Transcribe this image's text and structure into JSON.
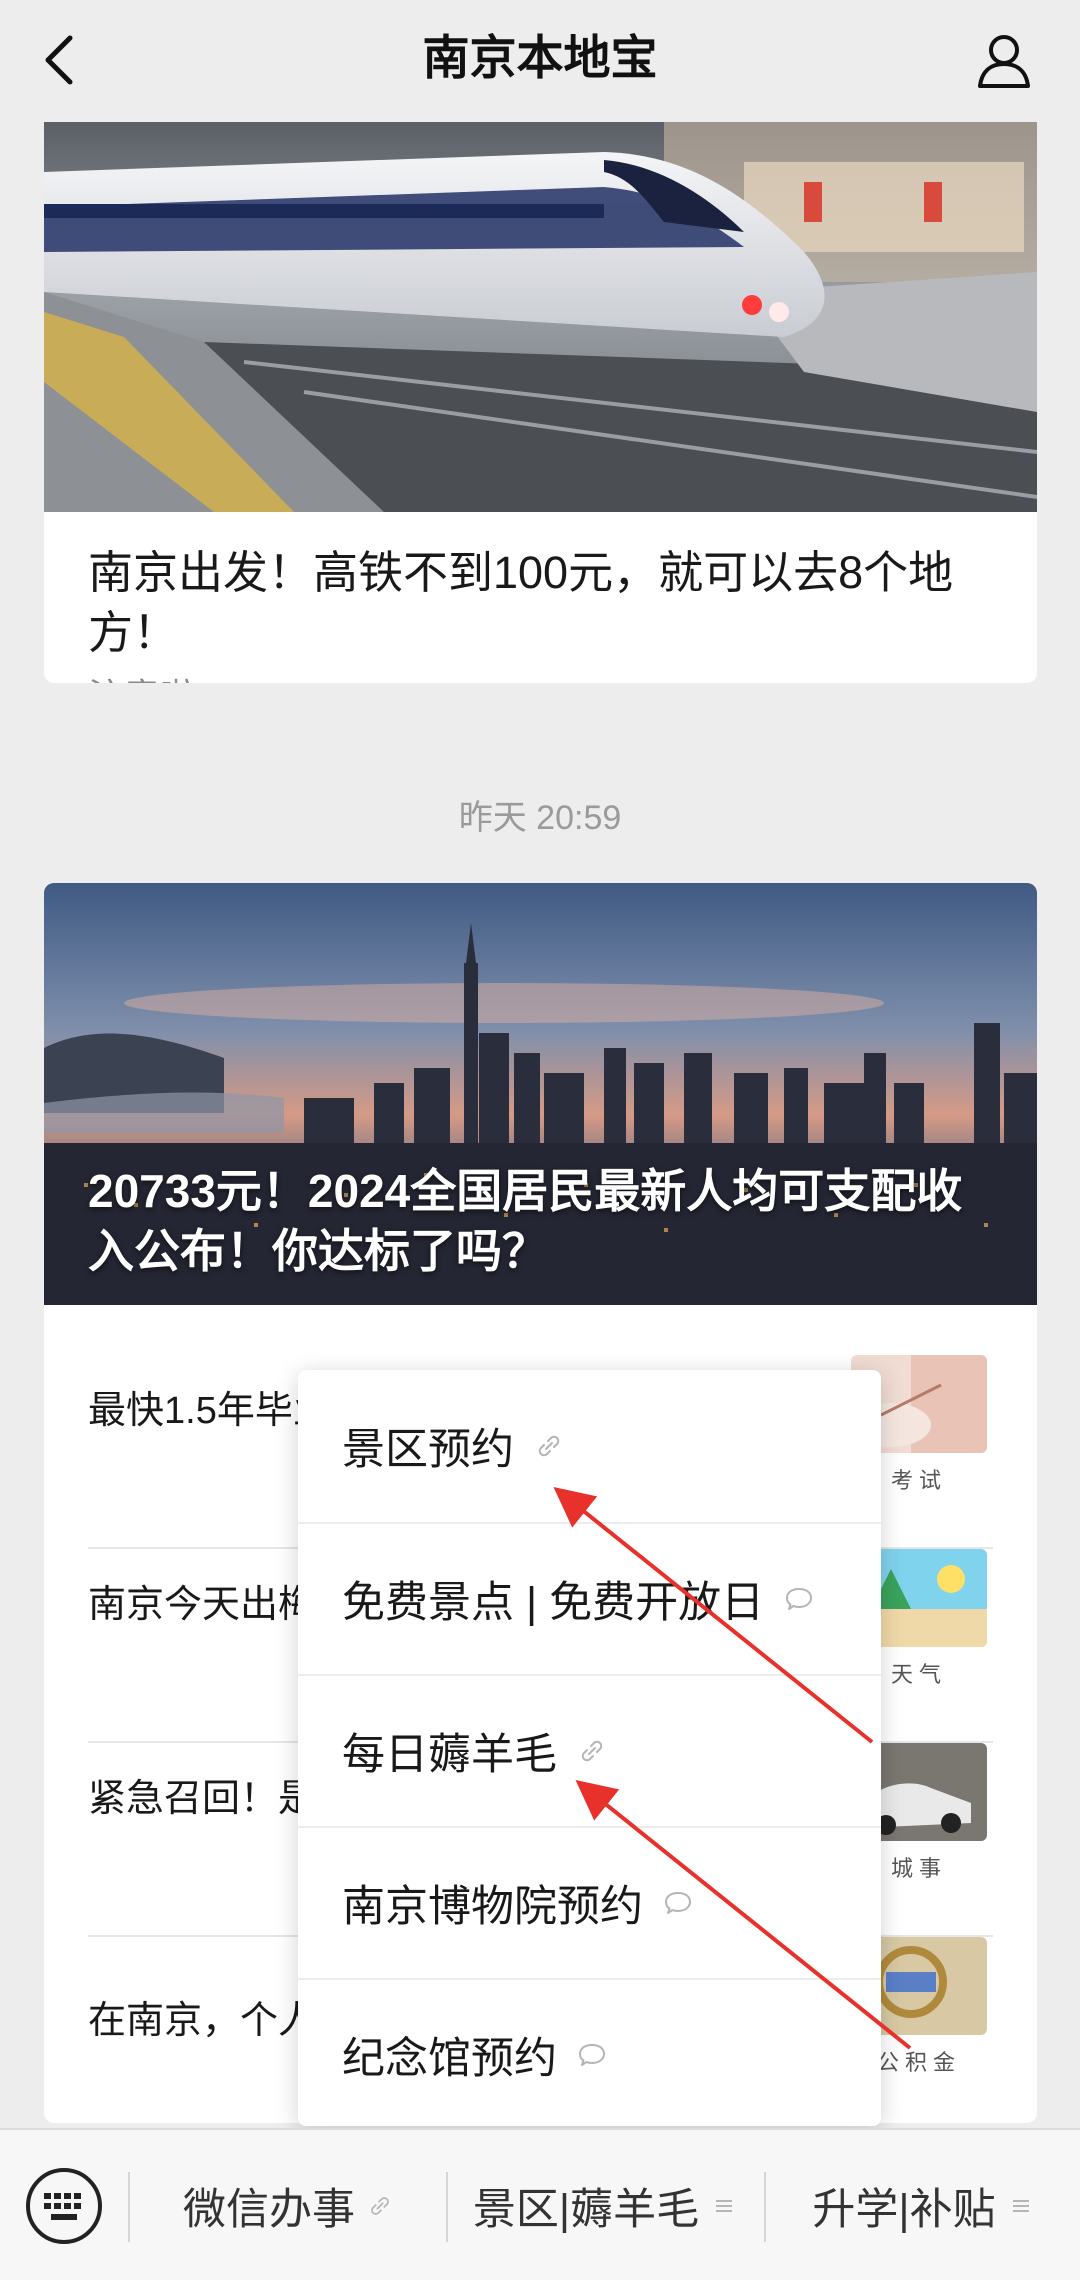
{
  "nav": {
    "title": "南京本地宝",
    "back_icon": "chevron-left-icon",
    "profile_icon": "person-icon"
  },
  "article1": {
    "title": "南京出发！高铁不到100元，就可以去8个地方！",
    "source": "注意啦"
  },
  "timestamp": "昨天 20:59",
  "article2": {
    "cover_title": "20733元！2024全国居民最新人均可支配收入公布！你达标了吗？",
    "items": [
      {
        "title": "最快1.5年毕业，想提升学历的赶紧看",
        "tag": "考试"
      },
      {
        "title": "南京今天出梅？最高36℃，难熬的天气",
        "tag": "天气"
      },
      {
        "title": "紧急召回！是你的爱车？",
        "tag": "城事"
      },
      {
        "title": "在南京，个人公积金",
        "tag": "公积金"
      }
    ]
  },
  "popup": {
    "items": [
      {
        "label": "景区预约",
        "icon": "link-icon"
      },
      {
        "label": "免费景点 | 免费开放日",
        "icon": "chat-bubble-icon"
      },
      {
        "label": "每日薅羊毛",
        "icon": "link-icon"
      },
      {
        "label": "南京博物院预约",
        "icon": "chat-bubble-icon"
      },
      {
        "label": "纪念馆预约",
        "icon": "chat-bubble-icon"
      }
    ]
  },
  "bottom_menu": {
    "keyboard_icon": "keyboard-icon",
    "items": [
      {
        "label": "微信办事",
        "icon": "link-icon"
      },
      {
        "label": "景区|薅羊毛",
        "icon": "menu-lines-icon"
      },
      {
        "label": "升学|补贴",
        "icon": "menu-lines-icon"
      }
    ]
  },
  "colors": {
    "background": "#ededed",
    "card": "#ffffff",
    "arrow": "#e8312a",
    "muted_text": "#8a8a8a"
  }
}
